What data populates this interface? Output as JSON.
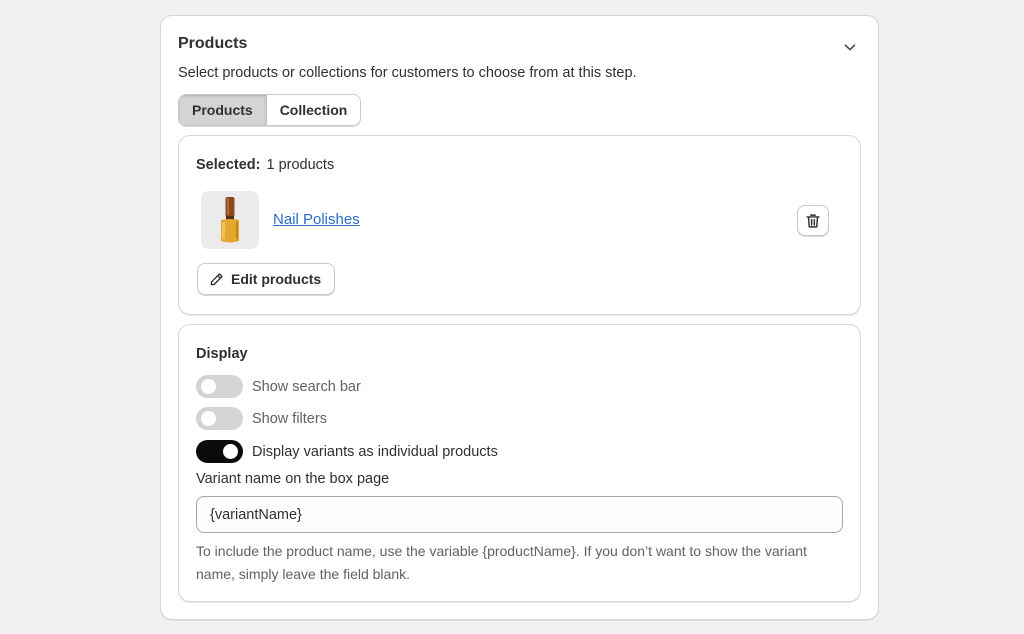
{
  "card": {
    "title": "Products",
    "subtitle": "Select products or collections for customers to choose from at this step."
  },
  "tabs": [
    {
      "label": "Products",
      "active": true
    },
    {
      "label": "Collection",
      "active": false
    }
  ],
  "selected": {
    "label": "Selected:",
    "count_text": "1 products",
    "product_name": "Nail Polishes",
    "edit_label": "Edit products"
  },
  "display": {
    "title": "Display",
    "toggles": [
      {
        "label": "Show search bar",
        "on": false
      },
      {
        "label": "Show filters",
        "on": false
      },
      {
        "label": "Display variants as individual products",
        "on": true
      }
    ],
    "variant_field_label": "Variant name on the box page",
    "variant_field_value": "{variantName}",
    "help_text": "To include the product name, use the variable {productName}. If you don’t want to show the variant name, simply leave the field blank."
  },
  "colors": {
    "link": "#2c6ecb",
    "toggle_on": "#0b0b0b",
    "toggle_off": "#d4d4d4"
  },
  "icons": {
    "collapse": "chevron-down-icon",
    "delete": "trash-icon",
    "edit": "pencil-icon"
  }
}
